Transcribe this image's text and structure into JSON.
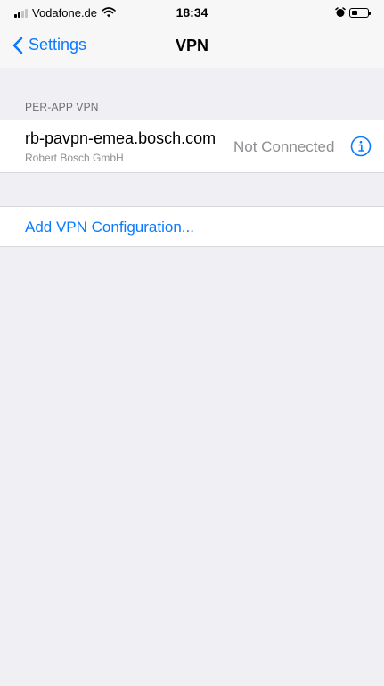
{
  "status_bar": {
    "carrier": "Vodafone.de",
    "time": "18:34",
    "battery_level_fraction": 0.35,
    "icons": [
      "signal-icon",
      "wifi-icon",
      "alarm-icon",
      "battery-icon"
    ]
  },
  "nav": {
    "back_label": "Settings",
    "title": "VPN",
    "back_icon": "chevron-left-icon"
  },
  "per_app_vpn": {
    "header": "PER-APP VPN",
    "items": [
      {
        "name": "rb-pavpn-emea.bosch.com",
        "organization": "Robert Bosch GmbH",
        "status": "Not Connected",
        "action_icon": "info-icon"
      }
    ]
  },
  "actions": {
    "add_configuration": "Add VPN Configuration..."
  },
  "colors": {
    "accent": "#0a7aff",
    "background": "#efeff4",
    "secondary_text": "#8e8e93"
  }
}
